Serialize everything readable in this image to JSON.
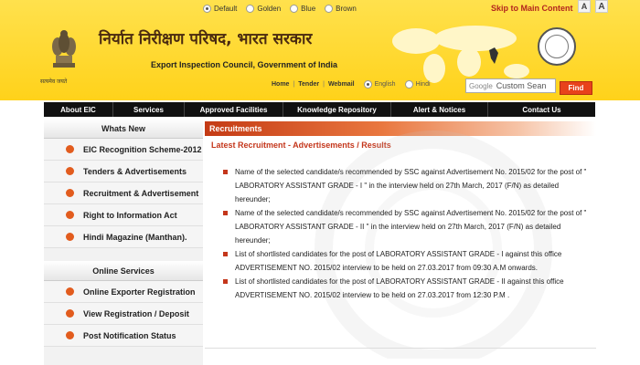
{
  "themes": [
    {
      "label": "Default",
      "selected": true
    },
    {
      "label": "Golden",
      "selected": false
    },
    {
      "label": "Blue",
      "selected": false
    },
    {
      "label": "Brown",
      "selected": false
    }
  ],
  "skip_link": "Skip to Main Content",
  "font_buttons": [
    "A",
    "A"
  ],
  "header": {
    "hindi_title": "निर्यात निरीक्षण परिषद, भारत सरकार",
    "english_title": "Export Inspection Council, Government of India",
    "motto": "सत्यमेव जयते"
  },
  "top_links": [
    "Home",
    "Tender",
    "Webmail"
  ],
  "languages": [
    {
      "label": "English",
      "selected": true
    },
    {
      "label": "Hindi",
      "selected": false
    }
  ],
  "search": {
    "brand": "Google",
    "placeholder": "Custom Sean"
  },
  "find_label": "Find",
  "nav": [
    "About EIC",
    "Services",
    "Approved Facilities",
    "Knowledge Repository",
    "Alert & Notices",
    "Contact Us"
  ],
  "whats_new": {
    "title": "Whats New",
    "items": [
      "EIC Recognition Scheme-2012",
      "Tenders & Advertisements",
      "Recruitment & Advertisement",
      "Right to Information Act",
      "Hindi Magazine (Manthan)."
    ]
  },
  "online_services": {
    "title": "Online Services",
    "items": [
      "Online Exporter Registration",
      "View Registration / Deposit",
      "Post Notification Status"
    ]
  },
  "recruitments": {
    "title": "Recruitments",
    "subtitle": "Latest Recruitment - Advertisements / Results",
    "items": [
      "Name of the selected candidate/s recommended by SSC against Advertisement No. 2015/02 for the post of \" LABORATORY ASSISTANT GRADE - I \" in the interview held on 27th March, 2017 (F/N) as detailed hereunder;",
      "Name of the selected candidate/s recommended by SSC against Advertisement No. 2015/02 for the post of \" LABORATORY ASSISTANT GRADE - II \" in the interview held on 27th March, 2017 (F/N) as detailed hereunder;",
      "List of shortlisted candidates for the post of LABORATORY ASSISTANT GRADE - I against this office ADVERTISEMENT NO. 2015/02 interview to be held on 27.03.2017 from 09:30 A.M onwards.",
      "List of shortlisted candidates for the post of LABORATORY ASSISTANT GRADE - II against this office ADVERTISEMENT NO. 2015/02 interview to be held on 27.03.2017 from 12:30 P.M ."
    ]
  },
  "colors": {
    "header_yellow": "#ffd21a",
    "accent_red": "#c4361b",
    "nav_black": "#111111"
  }
}
